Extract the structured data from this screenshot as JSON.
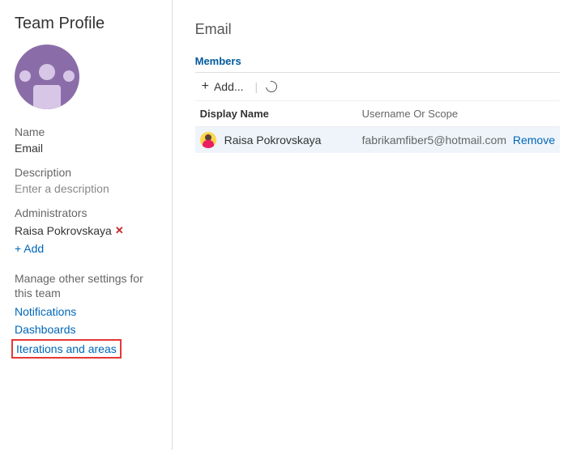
{
  "sidebar": {
    "title": "Team Profile",
    "nameLabel": "Name",
    "nameValue": "Email",
    "descLabel": "Description",
    "descPlaceholder": "Enter a description",
    "adminsLabel": "Administrators",
    "admins": [
      {
        "displayName": "Raisa Pokrovskaya"
      }
    ],
    "addLabel": "+ Add",
    "settingsHeading": "Manage other settings for this team",
    "links": {
      "notifications": "Notifications",
      "dashboards": "Dashboards",
      "iterations": "Iterations and areas"
    }
  },
  "main": {
    "title": "Email",
    "tab": "Members",
    "toolbar": {
      "addLabel": "Add..."
    },
    "columns": {
      "displayName": "Display Name",
      "username": "Username Or Scope"
    },
    "members": [
      {
        "displayName": "Raisa Pokrovskaya",
        "username": "fabrikamfiber5@hotmail.com",
        "removeLabel": "Remove"
      }
    ]
  }
}
